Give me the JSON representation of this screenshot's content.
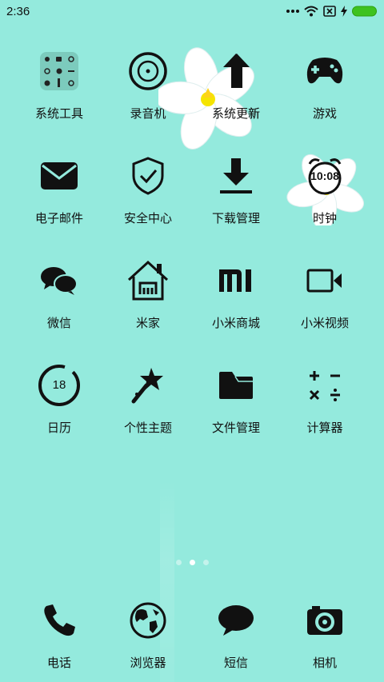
{
  "status_bar": {
    "time": "2:36",
    "battery_color": "#3ec21f"
  },
  "apps": [
    {
      "label": "系统工具",
      "icon": "system-tools-folder-icon"
    },
    {
      "label": "录音机",
      "icon": "recorder-icon"
    },
    {
      "label": "系统更新",
      "icon": "system-update-icon"
    },
    {
      "label": "游戏",
      "icon": "gamepad-icon"
    },
    {
      "label": "电子邮件",
      "icon": "email-icon"
    },
    {
      "label": "安全中心",
      "icon": "security-shield-icon"
    },
    {
      "label": "下载管理",
      "icon": "download-icon"
    },
    {
      "label": "时钟",
      "icon": "clock-icon",
      "clock_time": "10:08"
    },
    {
      "label": "微信",
      "icon": "wechat-icon"
    },
    {
      "label": "米家",
      "icon": "mijia-home-icon"
    },
    {
      "label": "小米商城",
      "icon": "mi-store-icon"
    },
    {
      "label": "小米视频",
      "icon": "video-camera-icon"
    },
    {
      "label": "日历",
      "icon": "calendar-icon",
      "calendar_day": "18"
    },
    {
      "label": "个性主题",
      "icon": "themes-icon"
    },
    {
      "label": "文件管理",
      "icon": "folder-icon"
    },
    {
      "label": "计算器",
      "icon": "calculator-icon"
    }
  ],
  "pager": {
    "pages": 3,
    "current": 2
  },
  "dock": [
    {
      "label": "电话",
      "icon": "phone-icon"
    },
    {
      "label": "浏览器",
      "icon": "globe-icon"
    },
    {
      "label": "短信",
      "icon": "message-bubble-icon"
    },
    {
      "label": "相机",
      "icon": "camera-icon"
    }
  ],
  "colors": {
    "background": "#94eadd",
    "icon": "#111111"
  }
}
